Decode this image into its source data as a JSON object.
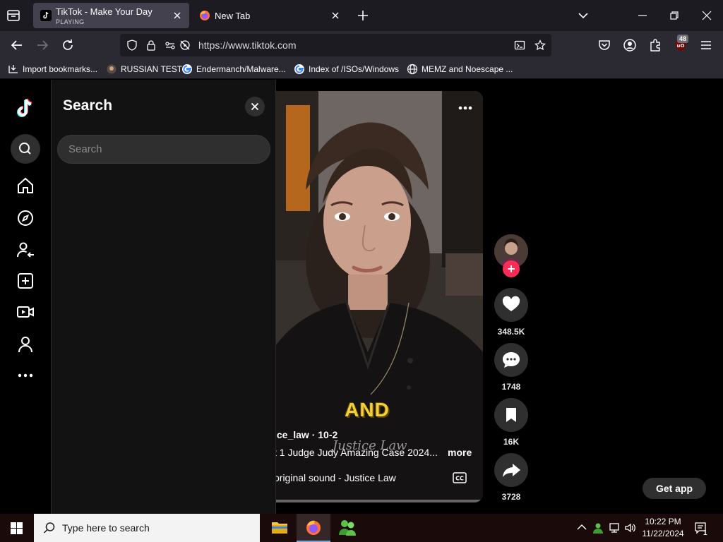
{
  "browser": {
    "tabs": [
      {
        "title": "TikTok - Make Your Day",
        "status": "PLAYING",
        "active": true
      },
      {
        "title": "New Tab",
        "active": false
      }
    ],
    "url": "https://www.tiktok.com",
    "extension_badge": "48",
    "bookmarks": [
      {
        "label": "Import bookmarks...",
        "icon": "import-icon"
      },
      {
        "label": "RUSSIAN TEST",
        "icon": "site-favicon"
      },
      {
        "label": "Endermanch/Malware...",
        "icon": "google-icon"
      },
      {
        "label": "Index of /ISOs/Windows",
        "icon": "google-icon"
      },
      {
        "label": "MEMZ and Noescape ...",
        "icon": "globe-icon"
      }
    ]
  },
  "tiktok": {
    "nav": [
      "tiktok-logo",
      "search-icon",
      "home-icon",
      "explore-icon",
      "following-icon",
      "upload-icon",
      "live-icon",
      "profile-icon",
      "more-icon"
    ],
    "search_panel": {
      "heading": "Search",
      "placeholder": "Search"
    },
    "video": {
      "caption_overlay": "AND",
      "author": "ice_law · 10-2",
      "description": "t 1 Judge Judy Amazing Case 2024...",
      "more_label": "more",
      "sound": "original sound - Justice Law",
      "watermark": "Justice Law"
    },
    "actions": {
      "likes": "348.5K",
      "comments": "1748",
      "saves": "16K",
      "shares": "3728"
    },
    "get_app_label": "Get app"
  },
  "taskbar": {
    "search_placeholder": "Type here to search",
    "time": "10:22 PM",
    "date": "11/22/2024",
    "notification_count": "1"
  },
  "colors": {
    "tiktok_red": "#fe2c55",
    "tiktok_cyan": "#25f4ee",
    "caption_yellow": "#f4cf3a"
  }
}
